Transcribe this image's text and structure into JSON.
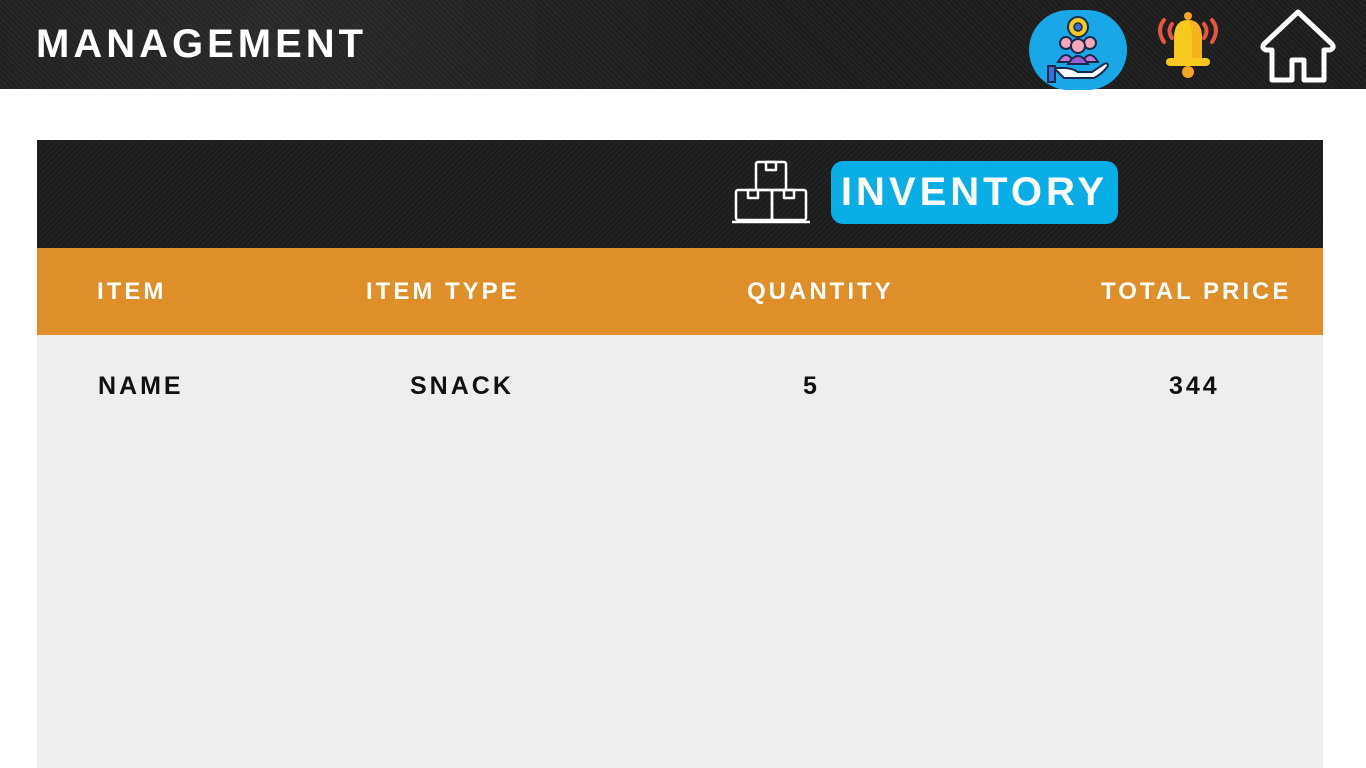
{
  "header": {
    "title": "MANAGEMENT",
    "icons": {
      "management": "people-management-icon",
      "notifications": "bell-icon",
      "home": "home-icon"
    }
  },
  "inventory": {
    "title": "INVENTORY",
    "icon": "boxes-icon",
    "columns": [
      "ITEM",
      "ITEM TYPE",
      "QUANTITY",
      "TOTAL PRICE"
    ],
    "rows": [
      [
        "NAME",
        "SNACK",
        "5",
        "344"
      ]
    ]
  },
  "colors": {
    "header_bg": "#1e1e1e",
    "accent_blue": "#0aaee6",
    "column_header_orange": "#df8f29",
    "table_bg": "#eeeeee",
    "bell_yellow": "#f7c81e",
    "bell_wave_red": "#e8553f"
  }
}
